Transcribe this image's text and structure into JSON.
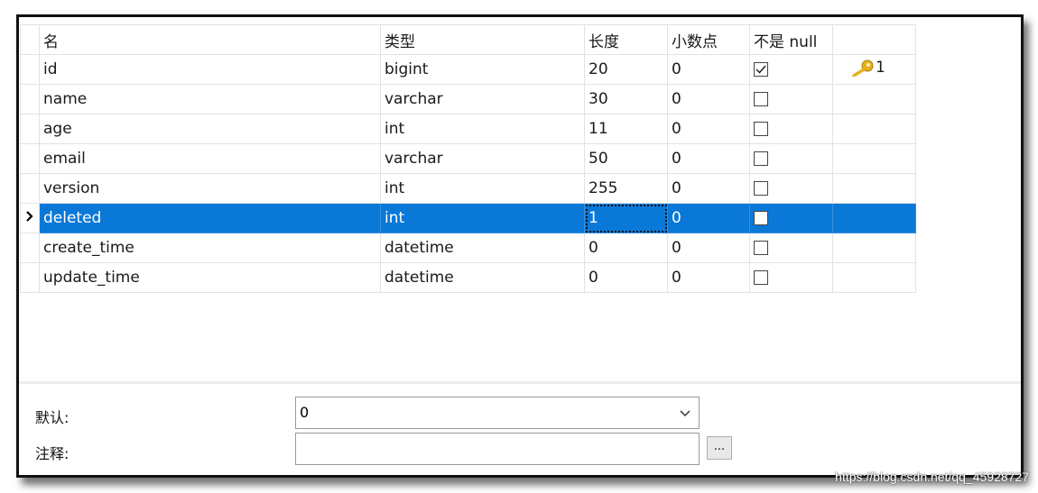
{
  "columns": {
    "name": "名",
    "type": "类型",
    "length": "长度",
    "decimals": "小数点",
    "not_null": "不是 null",
    "key": ""
  },
  "rows": [
    {
      "name": "id",
      "type": "bigint",
      "length": "20",
      "decimals": "0",
      "not_null": true,
      "key": "1"
    },
    {
      "name": "name",
      "type": "varchar",
      "length": "30",
      "decimals": "0",
      "not_null": false,
      "key": ""
    },
    {
      "name": "age",
      "type": "int",
      "length": "11",
      "decimals": "0",
      "not_null": false,
      "key": ""
    },
    {
      "name": "email",
      "type": "varchar",
      "length": "50",
      "decimals": "0",
      "not_null": false,
      "key": ""
    },
    {
      "name": "version",
      "type": "int",
      "length": "255",
      "decimals": "0",
      "not_null": false,
      "key": ""
    },
    {
      "name": "deleted",
      "type": "int",
      "length": "1",
      "decimals": "0",
      "not_null": false,
      "key": "",
      "selected": true
    },
    {
      "name": "create_time",
      "type": "datetime",
      "length": "0",
      "decimals": "0",
      "not_null": false,
      "key": ""
    },
    {
      "name": "update_time",
      "type": "datetime",
      "length": "0",
      "decimals": "0",
      "not_null": false,
      "key": ""
    }
  ],
  "properties": {
    "default_label": "默认:",
    "default_value": "0",
    "comment_label": "注释:",
    "comment_value": "",
    "ellipsis_label": "..."
  },
  "watermark": "https://blog.csdn.net/qq_45928727",
  "colors": {
    "selection": "#0a78d7",
    "key_icon": "#e8b020"
  }
}
